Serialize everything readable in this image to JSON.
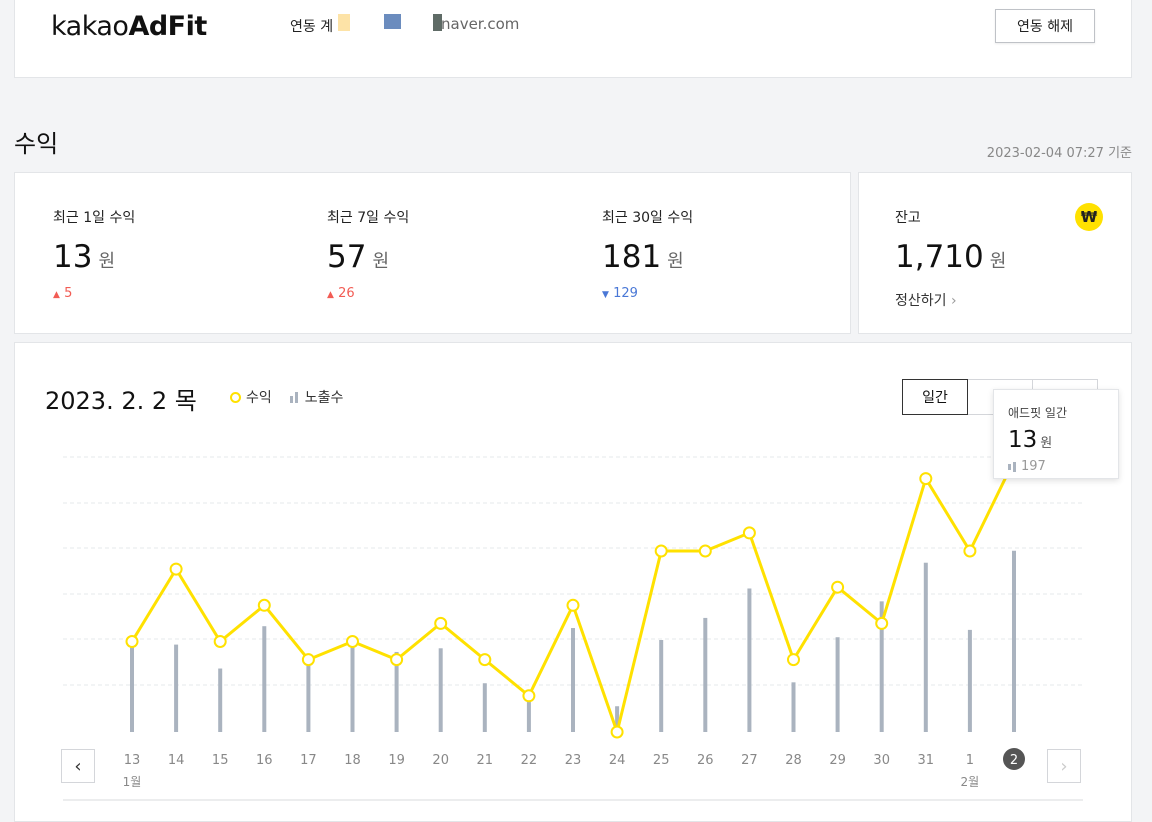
{
  "header": {
    "logo_light": "kakao",
    "logo_bold": "AdFit",
    "link_label": "연동 계",
    "account": "naver.com",
    "unlink_button": "연동 해제",
    "swatch_colors": [
      "#fde3a7",
      "#6b8cbe",
      "#5f6b66"
    ]
  },
  "revenue": {
    "title": "수익",
    "as_of": "2023-02-04 07:27 기준",
    "stats": [
      {
        "label": "최근 1일 수익",
        "value": "13",
        "unit": "원",
        "change": "5",
        "direction": "up"
      },
      {
        "label": "최근 7일 수익",
        "value": "57",
        "unit": "원",
        "change": "26",
        "direction": "up"
      },
      {
        "label": "최근 30일 수익",
        "value": "181",
        "unit": "원",
        "change": "129",
        "direction": "down"
      }
    ],
    "balance": {
      "label": "잔고",
      "value": "1,710",
      "unit": "원",
      "settle": "정산하기",
      "icon": "won-coin-icon"
    }
  },
  "chart_panel": {
    "date": "2023. 2. 2 목",
    "legend_revenue": "수익",
    "legend_impressions": "노출수",
    "tabs": [
      "일간",
      "",
      ""
    ],
    "active_tab": 0,
    "tooltip": {
      "title": "애드핏 일간",
      "value": "13",
      "unit": "원",
      "impressions": "197"
    }
  },
  "chart_data": {
    "type": "line",
    "categories": [
      "13",
      "14",
      "15",
      "16",
      "17",
      "18",
      "19",
      "20",
      "21",
      "22",
      "23",
      "24",
      "25",
      "26",
      "27",
      "28",
      "29",
      "30",
      "31",
      "1",
      "2"
    ],
    "month_labels": {
      "0": "1월",
      "19": "2월"
    },
    "highlight_index": 20,
    "series": [
      {
        "name": "수익",
        "type": "line",
        "color": "#ffe100",
        "values": [
          5,
          9,
          5,
          7,
          4,
          5,
          4,
          6,
          4,
          2,
          7,
          0,
          10,
          10,
          11,
          4,
          8,
          6,
          14,
          10,
          15
        ]
      },
      {
        "name": "노출수",
        "type": "bar",
        "color": "#aab3bf",
        "values": [
          100,
          95,
          69,
          115,
          74,
          100,
          87,
          91,
          53,
          38,
          113,
          28,
          100,
          124,
          156,
          54,
          103,
          142,
          184,
          111,
          197
        ]
      }
    ],
    "grid": true
  }
}
